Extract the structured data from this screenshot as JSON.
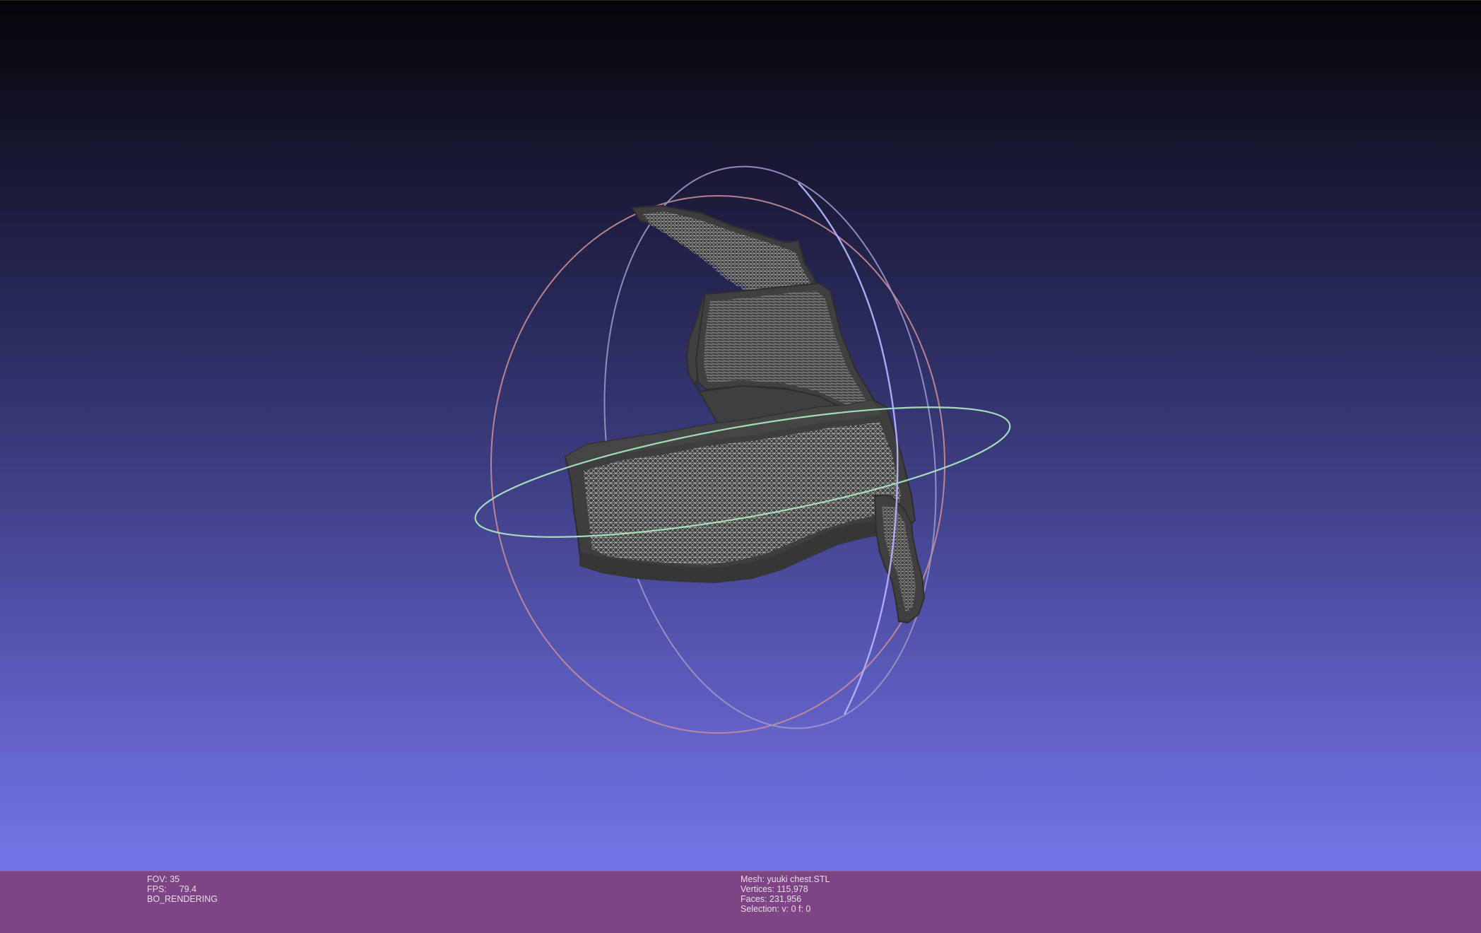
{
  "render_info": {
    "fov_label": "FOV:",
    "fov_value": "35",
    "fps_label": "FPS:",
    "fps_value": "79.4",
    "mode": "BO_RENDERING"
  },
  "mesh_info": {
    "mesh_label": "Mesh:",
    "mesh_name": "yuuki chest.STL",
    "vertices_label": "Vertices:",
    "vertices_value": "115,978",
    "faces_label": "Faces:",
    "faces_value": "231,956",
    "selection_label": "Selection:",
    "selection_value": "v: 0 f: 0"
  },
  "colors": {
    "status_bar": "#7e4585",
    "mesh_fill": "#3c3c3c",
    "wireframe": "#d9d9d9",
    "trackball_x": "#d98c8c",
    "trackball_y": "#a9a9ff",
    "trackball_z": "#a8e6b8"
  }
}
